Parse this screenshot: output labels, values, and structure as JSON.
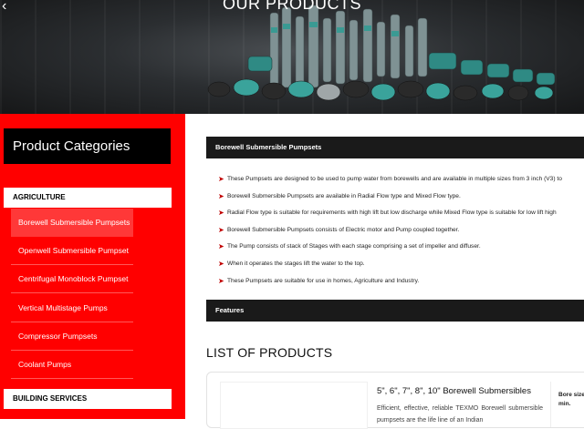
{
  "hero": {
    "title": "OUR PRODUCTS",
    "back_icon": "chevron-left-icon"
  },
  "sidebar": {
    "heading": "Product Categories",
    "sections": [
      {
        "label": "AGRICULTURE"
      },
      {
        "label": "BUILDING SERVICES"
      }
    ],
    "items": [
      {
        "label": "Borewell Submersible Pumpsets",
        "active": true
      },
      {
        "label": "Openwell Submersible Pumpset"
      },
      {
        "label": "Centrifugal Monoblock Pumpset"
      },
      {
        "label": "Vertical Multistage Pumps"
      },
      {
        "label": "Compressor Pumpsets"
      },
      {
        "label": "Coolant Pumps"
      }
    ]
  },
  "main": {
    "section_title": "Borewell Submersible Pumpsets",
    "bullets": [
      "These Pumpsets are designed to be used to pump water from borewells and are available in multiple sizes from 3 inch (V3) to",
      "Borewell Submersible Pumpsets are available in Radial Flow type and Mixed Flow type.",
      "Radial Flow type is suitable for requirements with high lift but low discharge while Mixed Flow type is suitable for low lift high",
      "Borewell Submersible Pumpsets consists of Electric motor and Pump coupled together.",
      "The Pump consists of stack of Stages with each stage comprising a set of impeller and diffuser.",
      "When it operates the stages lift the water to the top.",
      "These Pumpsets are suitable for use in homes, Agriculture and Industry."
    ],
    "features_title": "Features",
    "list_title": "LIST OF PRODUCTS",
    "product": {
      "title": "5\", 6\", 7\", 8\", 10\" Borewell Submersibles",
      "description": "Efficient, effective, reliable TEXMO Borewell submersible pumpsets are the life line of an Indian",
      "side_label": "Bore size min."
    }
  },
  "colors": {
    "accent": "#ff0000",
    "bullet_arrow": "#c00000",
    "bar": "#1a1a1a"
  }
}
